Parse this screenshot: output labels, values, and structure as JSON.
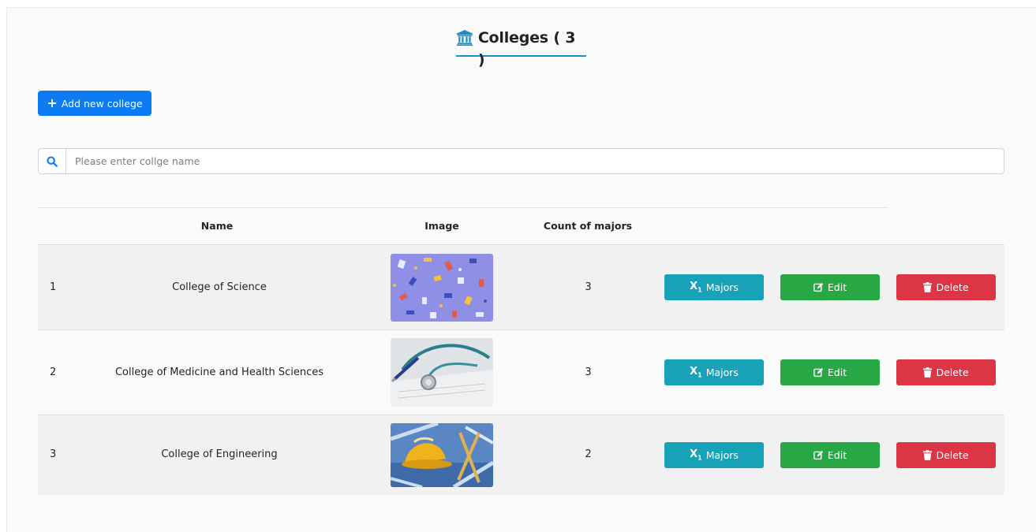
{
  "header": {
    "title": "Colleges ( 3 )",
    "icon": "university-icon",
    "accent": "#1a8fc8"
  },
  "toolbar": {
    "add_label": "Add new college",
    "add_icon": "plus-icon",
    "add_color": "#0d7cf2"
  },
  "search": {
    "placeholder": "Please enter collge name",
    "value": "",
    "icon": "search-icon"
  },
  "table": {
    "columns": [
      "",
      "Name",
      "Image",
      "Count of majors"
    ],
    "rows": [
      {
        "index": "1",
        "name": "College of Science",
        "image": "science-pattern-image",
        "count": "3"
      },
      {
        "index": "2",
        "name": "College of Medicine and Health Sciences",
        "image": "stethoscope-image",
        "count": "3"
      },
      {
        "index": "3",
        "name": "College of Engineering",
        "image": "hard-hat-blueprint-image",
        "count": "2"
      }
    ]
  },
  "actions": {
    "majors_label": "Majors",
    "edit_label": "Edit",
    "delete_label": "Delete",
    "majors_color": "#17a2b8",
    "edit_color": "#28a745",
    "delete_color": "#dc3545"
  }
}
